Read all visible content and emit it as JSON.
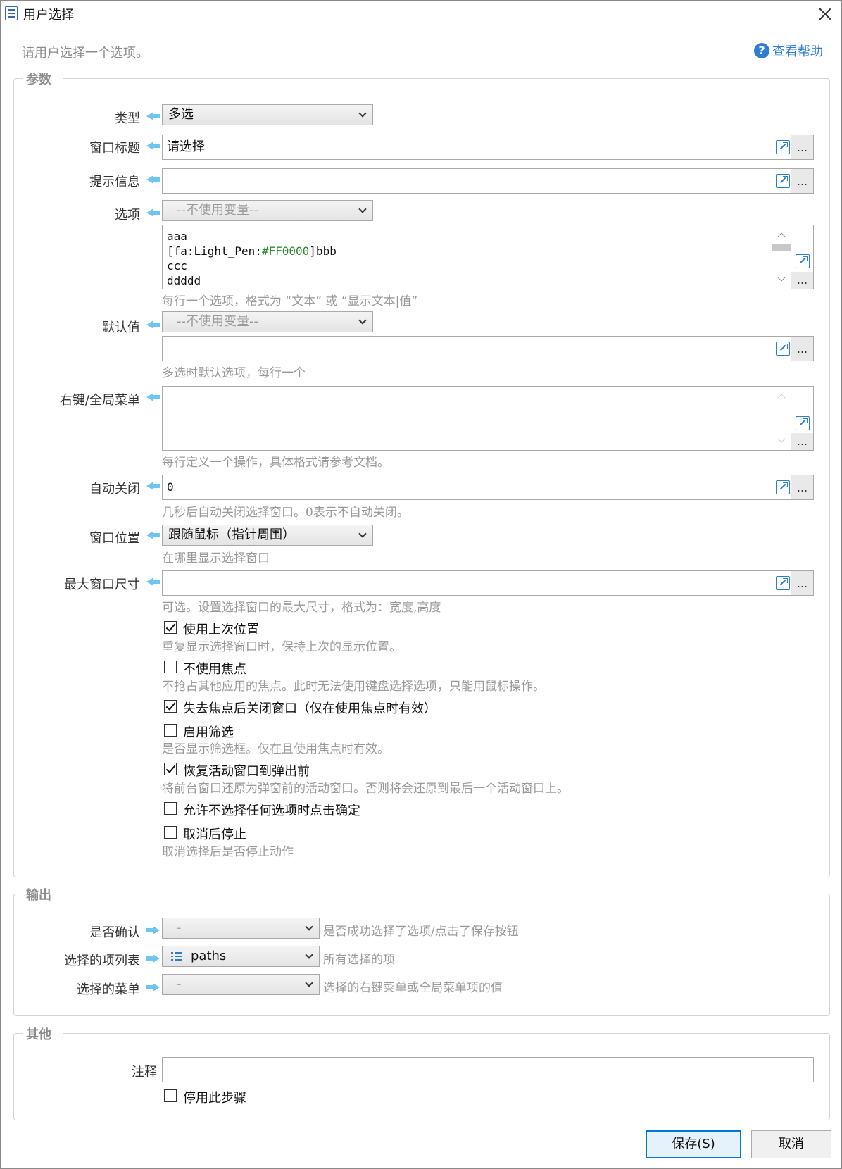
{
  "window": {
    "title": "用户选择"
  },
  "top": {
    "description": "请用户选择一个选项。",
    "help_label": "查看帮助",
    "help_icon": "?"
  },
  "params": {
    "legend": "参数",
    "type": {
      "label": "类型",
      "value": "多选"
    },
    "window_title": {
      "label": "窗口标题",
      "value": "请选择"
    },
    "prompt": {
      "label": "提示信息",
      "value": ""
    },
    "options": {
      "label": "选项",
      "var_select": "--不使用变量--",
      "lines": [
        "aaa",
        "[fa:Light_Pen:",
        "#FF0000",
        "]bbb",
        "ccc",
        "ddddd"
      ],
      "hint": "每行一个选项，格式为 “文本” 或 “显示文本|值”"
    },
    "default": {
      "label": "默认值",
      "var_select": "--不使用变量--",
      "value": "",
      "hint": "多选时默认选项，每行一个"
    },
    "context_menu": {
      "label": "右键/全局菜单",
      "value": "",
      "hint": "每行定义一个操作，具体格式请参考文档。"
    },
    "auto_close": {
      "label": "自动关闭",
      "value": "0",
      "hint": "几秒后自动关闭选择窗口。0表示不自动关闭。"
    },
    "position": {
      "label": "窗口位置",
      "value": "跟随鼠标（指针周围）",
      "hint": "在哪里显示选择窗口"
    },
    "max_size": {
      "label": "最大窗口尺寸",
      "value": "",
      "hint": "可选。设置选择窗口的最大尺寸，格式为：宽度,高度"
    },
    "dots": "...",
    "checkboxes": [
      {
        "label": "使用上次位置",
        "checked": true,
        "hint": "重复显示选择窗口时，保持上次的显示位置。"
      },
      {
        "label": "不使用焦点",
        "checked": false,
        "hint": "不抢占其他应用的焦点。此时无法使用键盘选择选项，只能用鼠标操作。"
      },
      {
        "label": "失去焦点后关闭窗口（仅在使用焦点时有效）",
        "checked": true,
        "hint": ""
      },
      {
        "label": "启用筛选",
        "checked": false,
        "hint": "是否显示筛选框。仅在且使用焦点时有效。"
      },
      {
        "label": "恢复活动窗口到弹出前",
        "checked": true,
        "hint": "将前台窗口还原为弹窗前的活动窗口。否则将会还原到最后一个活动窗口上。"
      },
      {
        "label": "允许不选择任何选项时点击确定",
        "checked": false,
        "hint": ""
      },
      {
        "label": "取消后停止",
        "checked": false,
        "hint": "取消选择后是否停止动作"
      }
    ]
  },
  "output": {
    "legend": "输出",
    "rows": [
      {
        "label": "是否确认",
        "value": "-",
        "hint": "是否成功选择了选项/点击了保存按钮"
      },
      {
        "label": "选择的项列表",
        "value": "paths",
        "hint": "所有选择的项"
      },
      {
        "label": "选择的菜单",
        "value": "-",
        "hint": "选择的右键菜单或全局菜单项的值"
      }
    ]
  },
  "other": {
    "legend": "其他",
    "comment": {
      "label": "注释",
      "value": ""
    },
    "disable_step": {
      "label": "停用此步骤",
      "checked": false
    }
  },
  "buttons": {
    "save": "保存(S)",
    "cancel": "取消"
  },
  "colors": {
    "accent": "#2d7dd2",
    "arrow": "#6ec6ee",
    "hint": "#9a9a9a",
    "focus_border": "#0078d7"
  }
}
